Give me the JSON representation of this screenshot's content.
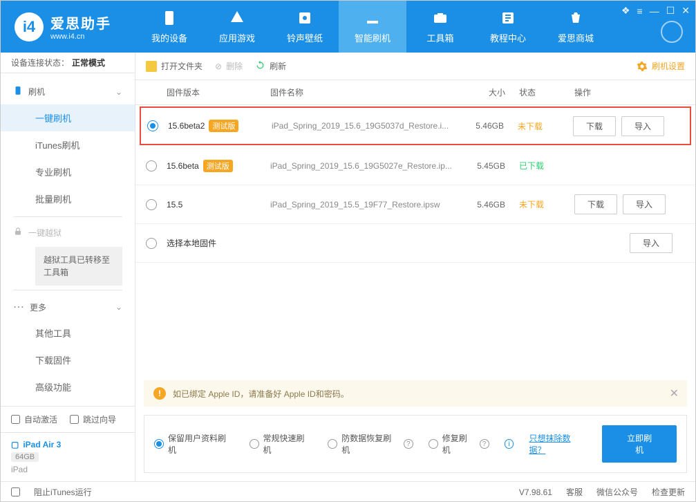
{
  "header": {
    "logo_cn": "爱思助手",
    "logo_en": "www.i4.cn",
    "tabs": [
      "我的设备",
      "应用游戏",
      "铃声壁纸",
      "智能刷机",
      "工具箱",
      "教程中心",
      "爱思商城"
    ],
    "active_tab": 3
  },
  "sidebar": {
    "status_label": "设备连接状态：",
    "status_value": "正常模式",
    "flash_head": "刷机",
    "items": [
      "一键刷机",
      "iTunes刷机",
      "专业刷机",
      "批量刷机"
    ],
    "active_item": 0,
    "jailbreak": "一键越狱",
    "jailbreak_note": "越狱工具已转移至工具箱",
    "more_head": "更多",
    "more_items": [
      "其他工具",
      "下载固件",
      "高级功能"
    ],
    "auto_activate": "自动激活",
    "skip_guide": "跳过向导",
    "device_name": "iPad Air 3",
    "device_storage": "64GB",
    "device_type": "iPad"
  },
  "toolbar": {
    "open": "打开文件夹",
    "delete": "删除",
    "refresh": "刷新",
    "settings": "刷机设置"
  },
  "table": {
    "headers": {
      "version": "固件版本",
      "name": "固件名称",
      "size": "大小",
      "status": "状态",
      "ops": "操作"
    },
    "rows": [
      {
        "selected": true,
        "version": "15.6beta2",
        "beta": "测试版",
        "name": "iPad_Spring_2019_15.6_19G5037d_Restore.i...",
        "size": "5.46GB",
        "status": "未下载",
        "status_class": "dl",
        "highlighted": true,
        "ops": [
          "下载",
          "导入"
        ]
      },
      {
        "selected": false,
        "version": "15.6beta",
        "beta": "测试版",
        "name": "iPad_Spring_2019_15.6_19G5027e_Restore.ip...",
        "size": "5.45GB",
        "status": "已下载",
        "status_class": "done",
        "ops": []
      },
      {
        "selected": false,
        "version": "15.5",
        "beta": "",
        "name": "iPad_Spring_2019_15.5_19F77_Restore.ipsw",
        "size": "5.46GB",
        "status": "未下载",
        "status_class": "dl",
        "ops": [
          "下载",
          "导入"
        ]
      },
      {
        "selected": false,
        "version": "选择本地固件",
        "beta": "",
        "name": "",
        "size": "",
        "status": "",
        "status_class": "",
        "ops": [
          "导入"
        ]
      }
    ]
  },
  "notice": "如已绑定 Apple ID，请准备好 Apple ID和密码。",
  "options": {
    "opts": [
      "保留用户资料刷机",
      "常规快速刷机",
      "防数据恢复刷机",
      "修复刷机"
    ],
    "selected": 0,
    "erase_link": "只想抹除数据？",
    "flash_btn": "立即刷机"
  },
  "footer": {
    "prevent_itunes": "阻止iTunes运行",
    "version": "V7.98.61",
    "items": [
      "客服",
      "微信公众号",
      "检查更新"
    ]
  }
}
